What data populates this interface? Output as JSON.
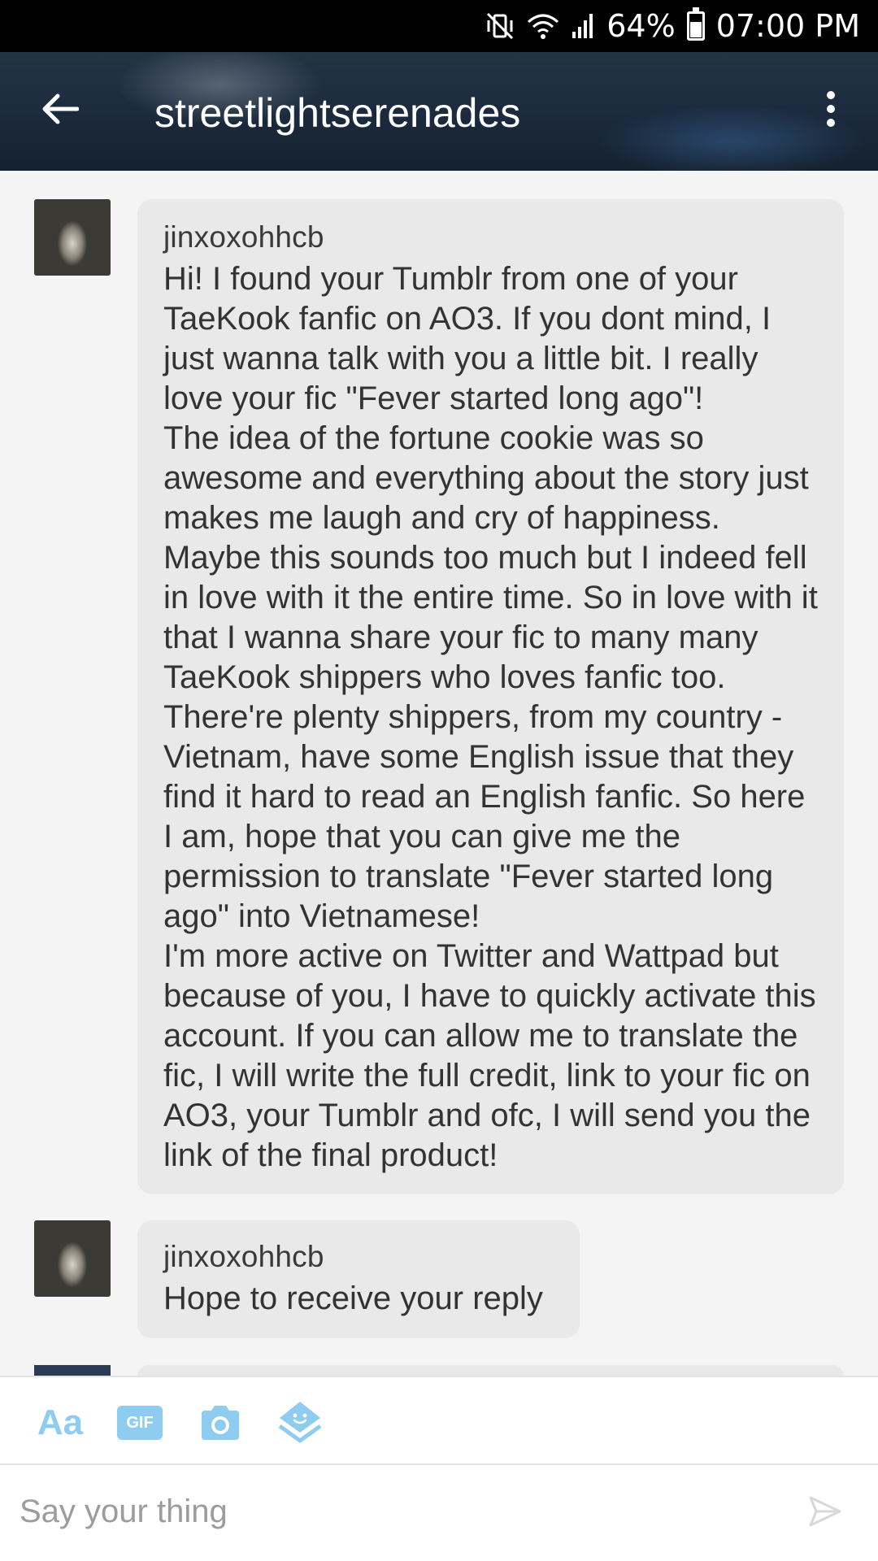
{
  "status_bar": {
    "battery": "64%",
    "time": "07:00 PM"
  },
  "header": {
    "title": "streetlightserenades",
    "back_icon": "arrow-left-icon",
    "menu_icon": "more-vertical-icon"
  },
  "messages": [
    {
      "username": "jinxoxohhcb",
      "text": "Hi! I found your Tumblr from one of your TaeKook fanfic on AO3. If you dont mind, I just wanna talk with you a little bit. I really love your fic \"Fever started long ago\"!\nThe idea of the fortune cookie was so awesome and everything about the story just makes me laugh and cry of happiness. Maybe this sounds too much but I indeed fell in love with it the entire time. So in love with it that I wanna share your fic to many many TaeKook shippers who loves fanfic too. There're plenty shippers, from my country - Vietnam, have some English issue that they find it hard to read an English fanfic. So here I am, hope that you can give me the permission to translate \"Fever started long ago\" into Vietnamese!\nI'm more active on Twitter and Wattpad but because of you, I have to quickly activate this account. If you can allow me to translate the fic, I will write the full credit, link to your fic on AO3, your Tumblr and ofc, I will send you the link of the final product!"
    },
    {
      "username": "jinxoxohhcb",
      "text": "Hope to receive your reply"
    }
  ],
  "compose": {
    "text_tool_label": "Aa",
    "gif_label": "GIF",
    "placeholder": "Say your thing",
    "camera_icon": "camera-icon",
    "sticker_icon": "sticker-icon",
    "send_icon": "send-icon"
  },
  "colors": {
    "accent": "#8fcdf0",
    "header_bg": "#1e2d40",
    "bubble_bg": "#e9e9e9",
    "page_bg": "#f4f4f4"
  }
}
